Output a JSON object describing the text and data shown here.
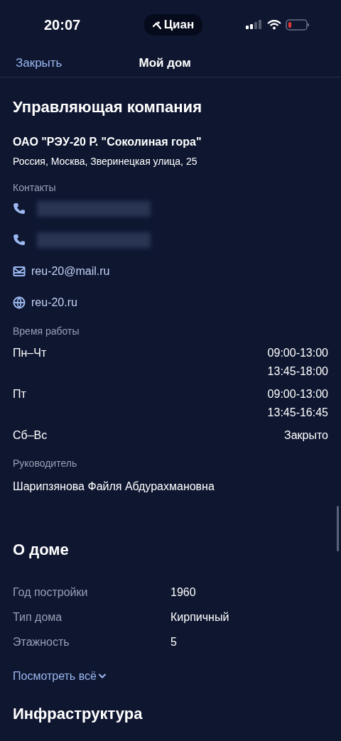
{
  "status_bar": {
    "time": "20:07",
    "app_badge": "Циан"
  },
  "nav": {
    "close": "Закрыть",
    "title": "Мой дом"
  },
  "company": {
    "heading": "Управляющая компания",
    "name": "ОАО \"РЭУ-20 Р. \"Соколиная гора\"",
    "address": "Россия, Москва, Зверинецкая улица, 25",
    "contacts_label": "Контакты",
    "contacts": [
      {
        "kind": "phone"
      },
      {
        "kind": "phone"
      },
      {
        "kind": "email",
        "text": "reu-20@mail.ru"
      },
      {
        "kind": "web",
        "text": "reu-20.ru"
      }
    ],
    "hours_label": "Время работы",
    "hours": [
      {
        "days": "Пн–Чт",
        "times": [
          "09:00-13:00",
          "13:45-18:00"
        ]
      },
      {
        "days": "Пт",
        "times": [
          "09:00-13:00",
          "13:45-16:45"
        ]
      },
      {
        "days": "Сб–Вс",
        "times": [
          "Закрыто"
        ]
      }
    ],
    "manager_label": "Руководитель",
    "manager": "Шарипзянова Файля Абдурахмановна"
  },
  "house": {
    "heading": "О доме",
    "rows": [
      {
        "label": "Год постройки",
        "value": "1960"
      },
      {
        "label": "Тип дома",
        "value": "Кирпичный"
      },
      {
        "label": "Этажность",
        "value": "5"
      }
    ],
    "more": "Посмотреть всё"
  },
  "infrastructure": {
    "heading": "Инфраструктура"
  }
}
